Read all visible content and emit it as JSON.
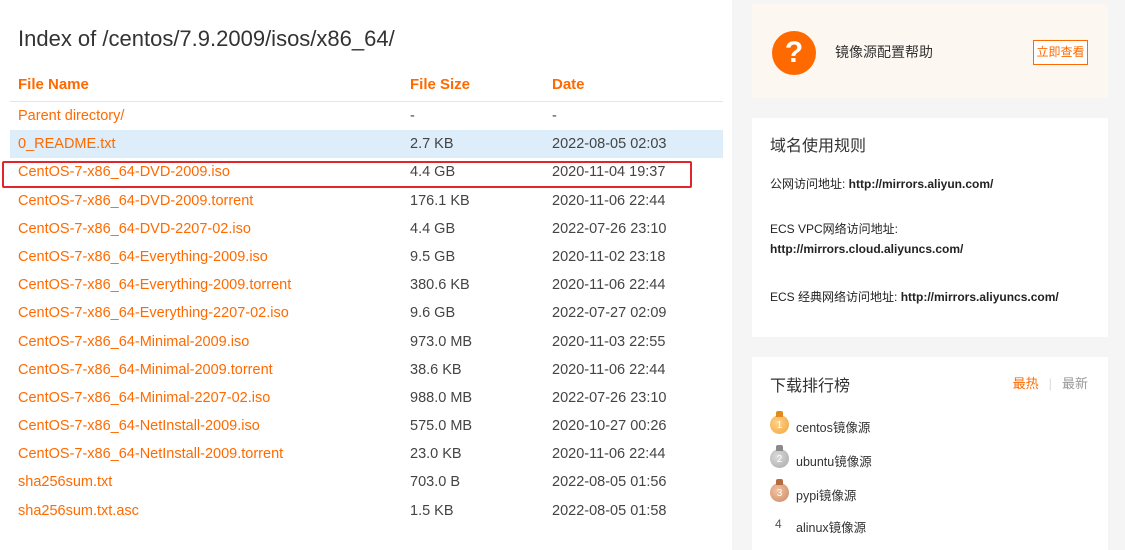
{
  "main": {
    "title": "Index of /centos/7.9.2009/isos/x86_64/",
    "headers": {
      "name": "File Name",
      "size": "File Size",
      "date": "Date"
    },
    "files": [
      {
        "name": "Parent directory/",
        "size": "-",
        "date": "-"
      },
      {
        "name": "0_README.txt",
        "size": "2.7 KB",
        "date": "2022-08-05 02:03"
      },
      {
        "name": "CentOS-7-x86_64-DVD-2009.iso",
        "size": "4.4 GB",
        "date": "2020-11-04 19:37"
      },
      {
        "name": "CentOS-7-x86_64-DVD-2009.torrent",
        "size": "176.1 KB",
        "date": "2020-11-06 22:44"
      },
      {
        "name": "CentOS-7-x86_64-DVD-2207-02.iso",
        "size": "4.4 GB",
        "date": "2022-07-26 23:10"
      },
      {
        "name": "CentOS-7-x86_64-Everything-2009.iso",
        "size": "9.5 GB",
        "date": "2020-11-02 23:18"
      },
      {
        "name": "CentOS-7-x86_64-Everything-2009.torrent",
        "size": "380.6 KB",
        "date": "2020-11-06 22:44"
      },
      {
        "name": "CentOS-7-x86_64-Everything-2207-02.iso",
        "size": "9.6 GB",
        "date": "2022-07-27 02:09"
      },
      {
        "name": "CentOS-7-x86_64-Minimal-2009.iso",
        "size": "973.0 MB",
        "date": "2020-11-03 22:55"
      },
      {
        "name": "CentOS-7-x86_64-Minimal-2009.torrent",
        "size": "38.6 KB",
        "date": "2020-11-06 22:44"
      },
      {
        "name": "CentOS-7-x86_64-Minimal-2207-02.iso",
        "size": "988.0 MB",
        "date": "2022-07-26 23:10"
      },
      {
        "name": "CentOS-7-x86_64-NetInstall-2009.iso",
        "size": "575.0 MB",
        "date": "2020-10-27 00:26"
      },
      {
        "name": "CentOS-7-x86_64-NetInstall-2009.torrent",
        "size": "23.0 KB",
        "date": "2020-11-06 22:44"
      },
      {
        "name": "sha256sum.txt",
        "size": "703.0 B",
        "date": "2022-08-05 01:56"
      },
      {
        "name": "sha256sum.txt.asc",
        "size": "1.5 KB",
        "date": "2022-08-05 01:58"
      }
    ]
  },
  "help": {
    "icon": "question-icon",
    "text": "镜像源配置帮助",
    "button": "立即查看"
  },
  "rules": {
    "title": "域名使用规则",
    "public_label": "公网访问地址: ",
    "public_url": "http://mirrors.aliyun.com/",
    "vpc_label": "ECS VPC网络访问地址:",
    "vpc_url": "http://mirrors.cloud.aliyuncs.com/",
    "classic_label": "ECS 经典网络访问地址: ",
    "classic_url": "http://mirrors.aliyuncs.com/"
  },
  "ranking": {
    "title": "下载排行榜",
    "tab_hot": "最热",
    "tab_new": "最新",
    "items": [
      {
        "rank": "1",
        "name": "centos镜像源"
      },
      {
        "rank": "2",
        "name": "ubuntu镜像源"
      },
      {
        "rank": "3",
        "name": "pypi镜像源"
      },
      {
        "rank": "4",
        "name": "alinux镜像源"
      }
    ]
  },
  "colors": {
    "accent": "#ff6a00",
    "highlight_row": "#ddeefa",
    "selection_box": "#e0262c"
  }
}
